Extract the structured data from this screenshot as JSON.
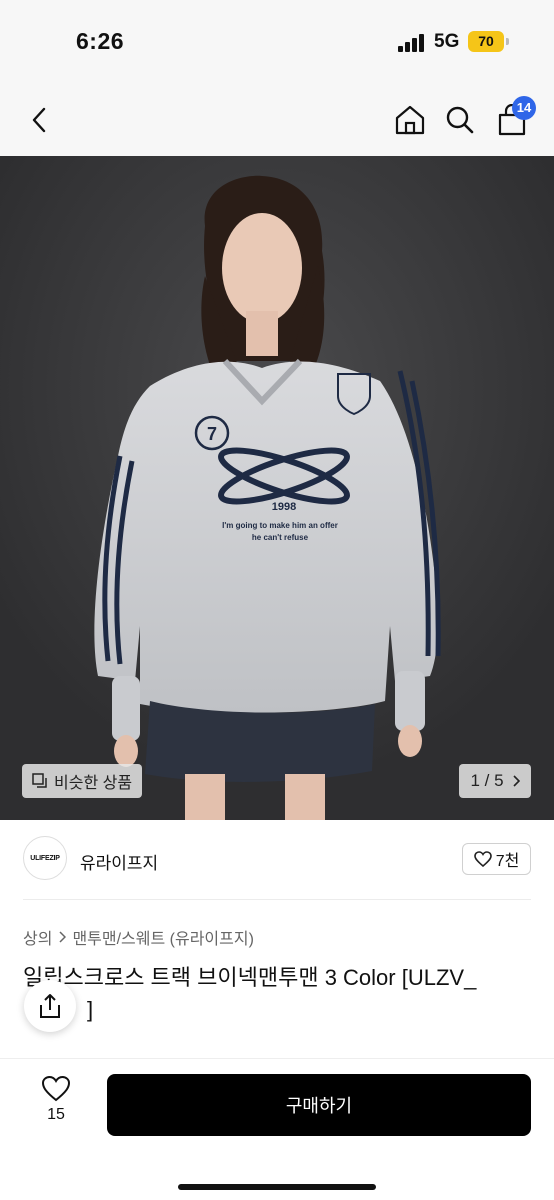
{
  "status_bar": {
    "time": "6:26",
    "network": "5G",
    "battery": "70",
    "battery_color": "#f5c518"
  },
  "nav": {
    "icons": [
      "back-arrow-icon",
      "home-icon",
      "search-icon",
      "cart-icon"
    ],
    "cart_badge": "14",
    "badge_color": "#2f66e8"
  },
  "gallery": {
    "similar_label": "비슷한 상품",
    "counter": "1 / 5",
    "print_year": "1998",
    "print_line1": "I'm going to make him an offer",
    "print_line2": "he can't refuse",
    "print_number": "7"
  },
  "brand": {
    "logo_text": "ULIFEZIP",
    "name": "유라이프지",
    "likes": "7천"
  },
  "product": {
    "breadcrumb": [
      "상의",
      "맨투맨/스웨트 (유라이프지)"
    ],
    "title": "일립스크로스 트랙 브이넥맨투맨 3 Color [ULZV_",
    "title_line2": "]"
  },
  "bottom": {
    "wish_count": "15",
    "buy_label": "구매하기",
    "buy_color": "#000000"
  }
}
